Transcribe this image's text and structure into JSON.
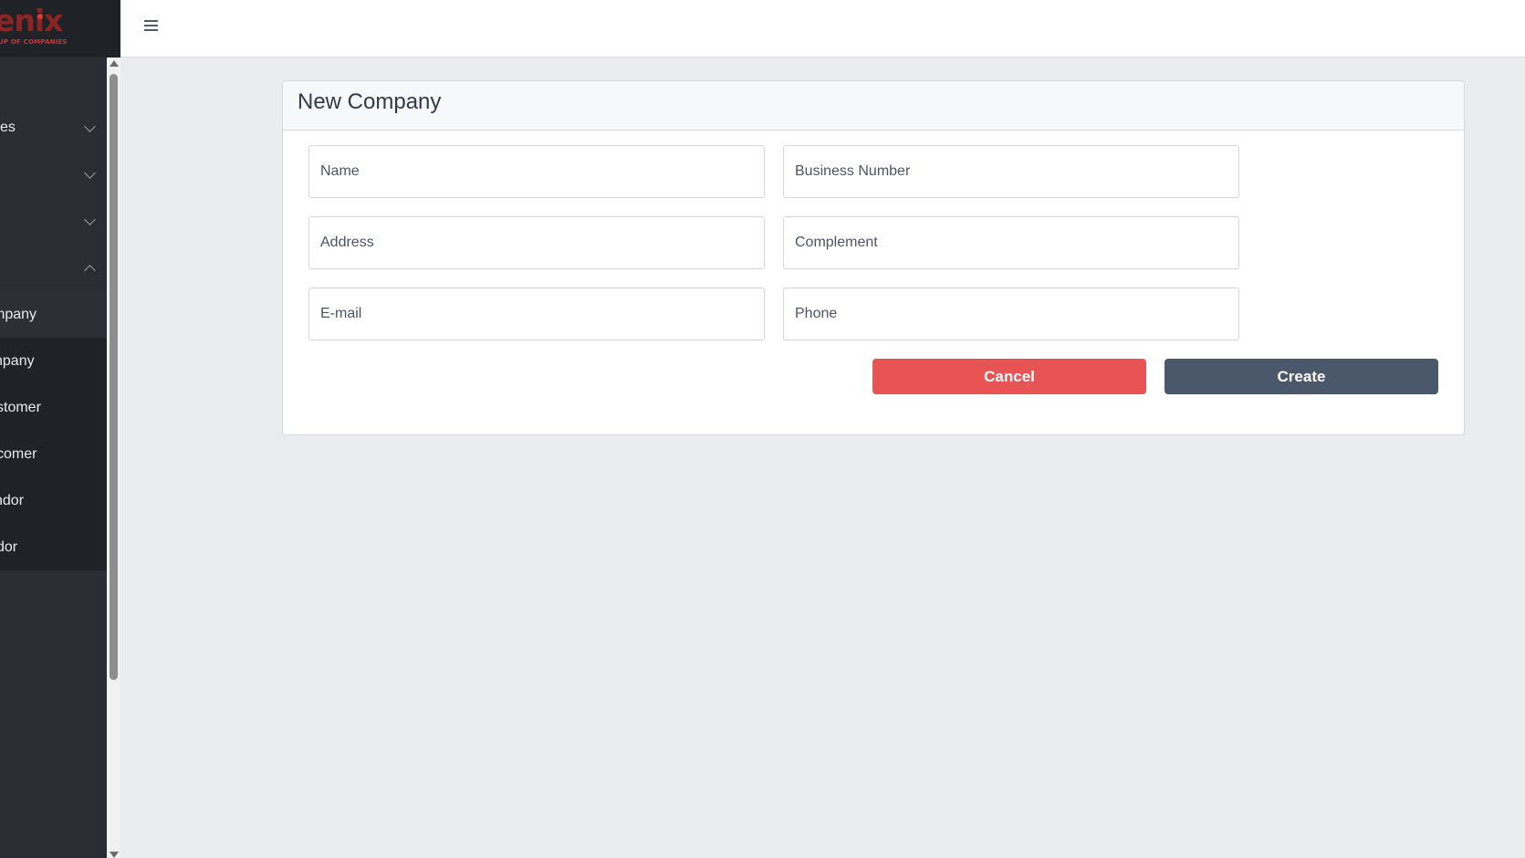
{
  "brand": {
    "logo_text": "enix",
    "logo_subtitle": "UP OF COMPANIES"
  },
  "sidebar": {
    "items": [
      {
        "label": "ces",
        "chevron": "down"
      },
      {
        "label": "",
        "chevron": "down"
      },
      {
        "label": "",
        "chevron": "down"
      },
      {
        "label": "",
        "chevron": "up"
      }
    ],
    "subitems": [
      {
        "label": "mpany",
        "active": true
      },
      {
        "label": "npany",
        "active": false
      },
      {
        "label": "stomer",
        "active": false
      },
      {
        "label": "comer",
        "active": false
      },
      {
        "label": "ndor",
        "active": false
      },
      {
        "label": "dor",
        "active": false
      }
    ]
  },
  "topbar": {
    "menu_icon": "hamburger-icon"
  },
  "form": {
    "title": "New Company",
    "fields": {
      "name": {
        "placeholder": "Name",
        "value": ""
      },
      "business_number": {
        "placeholder": "Business Number",
        "value": ""
      },
      "address": {
        "placeholder": "Address",
        "value": ""
      },
      "complement": {
        "placeholder": "Complement",
        "value": ""
      },
      "email": {
        "placeholder": "E-mail",
        "value": ""
      },
      "phone": {
        "placeholder": "Phone",
        "value": ""
      }
    },
    "cancel_label": "Cancel",
    "create_label": "Create"
  },
  "colors": {
    "sidebar_bg": "#2a2d33",
    "cancel": "#e85454",
    "create": "#4b576b",
    "page_bg": "#ebecee"
  }
}
